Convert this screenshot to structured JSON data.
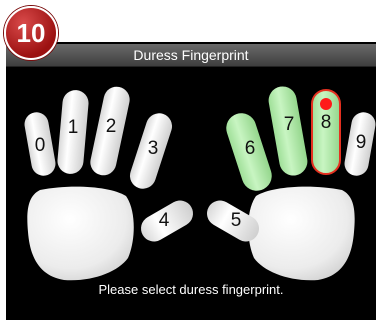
{
  "step_badge": "10",
  "window": {
    "title": "Duress Fingerprint"
  },
  "fingers": [
    {
      "label": "0",
      "state": "unselected"
    },
    {
      "label": "1",
      "state": "unselected"
    },
    {
      "label": "2",
      "state": "unselected"
    },
    {
      "label": "3",
      "state": "unselected"
    },
    {
      "label": "4",
      "state": "unselected"
    },
    {
      "label": "5",
      "state": "unselected"
    },
    {
      "label": "6",
      "state": "enrolled"
    },
    {
      "label": "7",
      "state": "enrolled"
    },
    {
      "label": "8",
      "state": "selected"
    },
    {
      "label": "9",
      "state": "unselected"
    }
  ],
  "status_text": "Please select duress fingerprint.",
  "colors": {
    "finger_default": "#f2f2f2",
    "finger_enrolled": "#b9f0b3",
    "selected_border": "#e53020",
    "selected_dot": "#ff1a1a",
    "badge": "#b51b1b"
  }
}
